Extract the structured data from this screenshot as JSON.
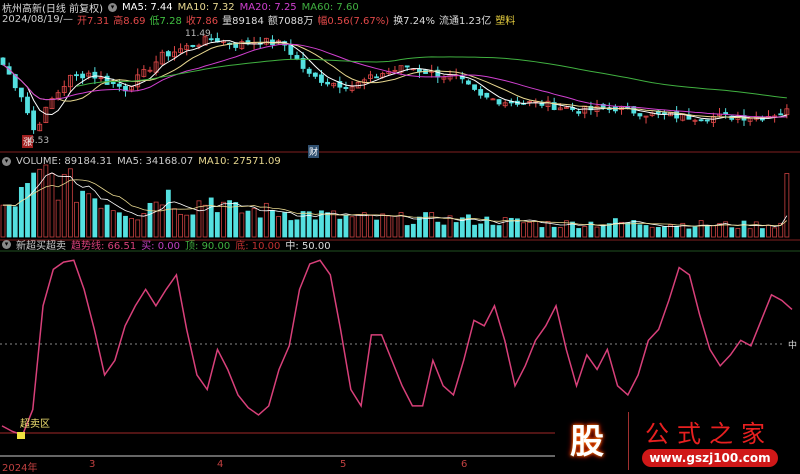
{
  "header": {
    "title": "杭州高新(日线 前复权)",
    "ma5": "MA5: 7.44",
    "ma10": "MA10: 7.32",
    "ma20": "MA20: 7.25",
    "ma60": "MA60: 7.60",
    "date": "2024/08/19/—",
    "open": "开7.31",
    "high": "高8.69",
    "low": "低7.28",
    "close": "收7.86",
    "vol": "量89184",
    "amount": "额7088万",
    "change": "幅0.56(7.67%)",
    "turnover": "换7.24%",
    "float": "流通1.23亿",
    "sector": "塑料"
  },
  "main": {
    "high_label": "11.49",
    "low_label": "6.53",
    "tag_zhang": "涨",
    "tag_cai": "财"
  },
  "volume": {
    "label": "VOLUME: 89184.31",
    "ma5": "MA5: 34168.07",
    "ma10": "MA10: 27571.09"
  },
  "osc": {
    "name": "新超买超卖",
    "trend": "趋势线: 66.51",
    "buy": "买: 0.00",
    "top": "顶: 90.00",
    "bottom": "底: 10.00",
    "mid": "中: 50.00",
    "mid_axis": "中",
    "oversold": "超卖区"
  },
  "axis": {
    "months": [
      "2024年",
      "3",
      "4",
      "5",
      "6"
    ]
  },
  "watermark": {
    "logo": "股",
    "name": "公式之家",
    "url": "www.gszj100.com"
  },
  "colors": {
    "up": "#e04848",
    "down": "#54e0e0",
    "ma5": "#ffffff",
    "ma10": "#e8d890",
    "ma20": "#d040d0",
    "ma60": "#40b040",
    "osc": "#d8407a"
  },
  "chart_data": [
    {
      "type": "candlestick",
      "title": "杭州高新 日线",
      "price_keypoints": [
        [
          0,
          10.0
        ],
        [
          3,
          8.6
        ],
        [
          5,
          7.0
        ],
        [
          6,
          7.4
        ],
        [
          8,
          8.4
        ],
        [
          11,
          9.4
        ],
        [
          14,
          9.6
        ],
        [
          17,
          9.2
        ],
        [
          20,
          8.9
        ],
        [
          23,
          9.6
        ],
        [
          26,
          10.4
        ],
        [
          30,
          10.8
        ],
        [
          34,
          11.2
        ],
        [
          38,
          10.9
        ],
        [
          42,
          11.1
        ],
        [
          46,
          10.9
        ],
        [
          50,
          9.5
        ],
        [
          53,
          9.2
        ],
        [
          57,
          9.0
        ],
        [
          62,
          9.6
        ],
        [
          66,
          9.9
        ],
        [
          70,
          9.6
        ],
        [
          74,
          9.4
        ],
        [
          78,
          8.5
        ],
        [
          82,
          8.3
        ],
        [
          88,
          8.2
        ],
        [
          94,
          7.9
        ],
        [
          100,
          8.0
        ],
        [
          106,
          7.7
        ],
        [
          112,
          7.6
        ],
        [
          118,
          7.6
        ],
        [
          124,
          7.6
        ],
        [
          128,
          7.86
        ]
      ],
      "ylim": [
        6.53,
        11.49
      ]
    },
    {
      "type": "bar",
      "title": "VOLUME",
      "volume_keypoints": [
        [
          0,
          40
        ],
        [
          4,
          70
        ],
        [
          7,
          98
        ],
        [
          10,
          80
        ],
        [
          14,
          70
        ],
        [
          18,
          50
        ],
        [
          22,
          35
        ],
        [
          26,
          70
        ],
        [
          30,
          45
        ],
        [
          34,
          60
        ],
        [
          38,
          40
        ],
        [
          44,
          40
        ],
        [
          50,
          35
        ],
        [
          56,
          30
        ],
        [
          62,
          28
        ],
        [
          70,
          28
        ],
        [
          80,
          25
        ],
        [
          90,
          20
        ],
        [
          100,
          22
        ],
        [
          110,
          20
        ],
        [
          120,
          18
        ],
        [
          127,
          20
        ],
        [
          128,
          89
        ]
      ]
    },
    {
      "type": "line",
      "title": "新超买超卖 趋势线",
      "ylim": [
        0,
        100
      ],
      "values": [
        5,
        2,
        0,
        14,
        71,
        91,
        95,
        96,
        80,
        58,
        33,
        41,
        60,
        71,
        80,
        71,
        80,
        88,
        58,
        33,
        25,
        47,
        36,
        22,
        15,
        11,
        16,
        36,
        49,
        80,
        94,
        96,
        88,
        58,
        25,
        16,
        55,
        55,
        41,
        27,
        16,
        16,
        41,
        27,
        22,
        41,
        63,
        60,
        71,
        52,
        27,
        38,
        52,
        60,
        71,
        47,
        27,
        44,
        36,
        47,
        27,
        22,
        33,
        52,
        58,
        74,
        92,
        88,
        66,
        47,
        38,
        44,
        52,
        49,
        63,
        77,
        74,
        69
      ]
    }
  ]
}
